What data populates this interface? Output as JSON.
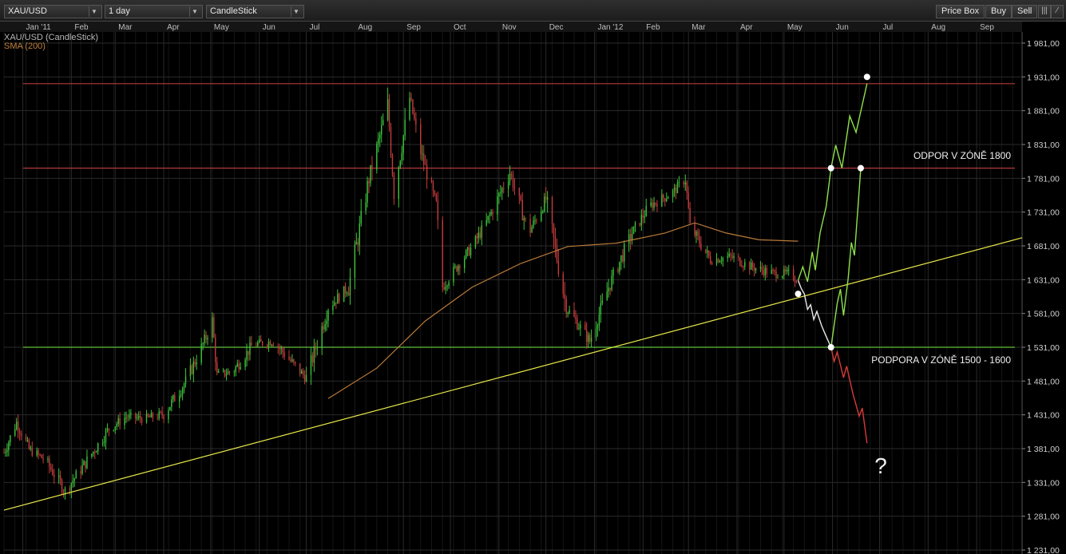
{
  "toolbar": {
    "symbol": "XAU/USD",
    "period": "1 day",
    "chart_type": "CandleStick",
    "price_box_label": "Price Box",
    "buy_label": "Buy",
    "sell_label": "Sell",
    "icons": [
      "bar-chart-icon",
      "draw-line-icon"
    ]
  },
  "legend": {
    "main": "XAU/USD (CandleStick)",
    "indicator": "SMA (200)"
  },
  "colors": {
    "background": "#000000",
    "grid": "#2a2a2a",
    "up_candle": "#3cc43c",
    "down_candle": "#c43c3c",
    "sma": "#b97a3a",
    "resistance": "#b33a3a",
    "support": "#5fbf3a",
    "trendline": "#e8e84a",
    "scenario_bull": "#8fe04a",
    "scenario_bear": "#d83a3a",
    "scenario_neutral": "#e8e8e8"
  },
  "annotations": {
    "resistance_label": "ODPOR V ZÓNĚ 1800",
    "support_label": "PODPORA V ZÓNĚ 1500 - 1600",
    "question_mark": "?"
  },
  "chart_data": {
    "type": "candlestick",
    "title": "",
    "xlabel": "",
    "ylabel": "",
    "ylim": [
      1231,
      1981
    ],
    "grid": true,
    "x_start": "2010-12-20",
    "x_end": "2012-09-30",
    "x_ticks": [
      {
        "label": "Jan '11",
        "date": "2011-01-01"
      },
      {
        "label": "Feb",
        "date": "2011-02-01"
      },
      {
        "label": "Mar",
        "date": "2011-03-01"
      },
      {
        "label": "Apr",
        "date": "2011-04-01"
      },
      {
        "label": "May",
        "date": "2011-05-01"
      },
      {
        "label": "Jun",
        "date": "2011-06-01"
      },
      {
        "label": "Jul",
        "date": "2011-07-01"
      },
      {
        "label": "Aug",
        "date": "2011-08-01"
      },
      {
        "label": "Sep",
        "date": "2011-09-01"
      },
      {
        "label": "Oct",
        "date": "2011-10-01"
      },
      {
        "label": "Nov",
        "date": "2011-11-01"
      },
      {
        "label": "Dec",
        "date": "2011-12-01"
      },
      {
        "label": "Jan '12",
        "date": "2012-01-01"
      },
      {
        "label": "Feb",
        "date": "2012-02-01"
      },
      {
        "label": "Mar",
        "date": "2012-03-01"
      },
      {
        "label": "Apr",
        "date": "2012-04-01"
      },
      {
        "label": "May",
        "date": "2012-05-01"
      },
      {
        "label": "Jun",
        "date": "2012-06-01"
      },
      {
        "label": "Jul",
        "date": "2012-07-01"
      },
      {
        "label": "Aug",
        "date": "2012-08-01"
      },
      {
        "label": "Sep",
        "date": "2012-09-01"
      }
    ],
    "y_ticks": [
      "1 981,00",
      "1 931,00",
      "1 881,00",
      "1 831,00",
      "1 781,00",
      "1 731,00",
      "1 681,00",
      "1 631,00",
      "1 581,00",
      "1 531,00",
      "1 481,00",
      "1 431,00",
      "1 381,00",
      "1 331,00",
      "1 281,00",
      "1 231,00"
    ],
    "y_tick_values": [
      1981,
      1931,
      1881,
      1831,
      1781,
      1731,
      1681,
      1631,
      1581,
      1531,
      1481,
      1431,
      1381,
      1331,
      1281,
      1231
    ],
    "price_path": [
      {
        "date": "2010-12-20",
        "close": 1375
      },
      {
        "date": "2010-12-28",
        "close": 1420
      },
      {
        "date": "2011-01-05",
        "close": 1380
      },
      {
        "date": "2011-01-15",
        "close": 1365
      },
      {
        "date": "2011-01-28",
        "close": 1318
      },
      {
        "date": "2011-02-10",
        "close": 1360
      },
      {
        "date": "2011-02-25",
        "close": 1410
      },
      {
        "date": "2011-03-08",
        "close": 1428
      },
      {
        "date": "2011-03-20",
        "close": 1425
      },
      {
        "date": "2011-04-01",
        "close": 1432
      },
      {
        "date": "2011-04-15",
        "close": 1480
      },
      {
        "date": "2011-04-28",
        "close": 1545
      },
      {
        "date": "2011-05-02",
        "close": 1570
      },
      {
        "date": "2011-05-05",
        "close": 1490
      },
      {
        "date": "2011-05-15",
        "close": 1495
      },
      {
        "date": "2011-05-28",
        "close": 1535
      },
      {
        "date": "2011-06-10",
        "close": 1540
      },
      {
        "date": "2011-06-25",
        "close": 1500
      },
      {
        "date": "2011-07-01",
        "close": 1485
      },
      {
        "date": "2011-07-15",
        "close": 1590
      },
      {
        "date": "2011-07-28",
        "close": 1620
      },
      {
        "date": "2011-08-10",
        "close": 1780
      },
      {
        "date": "2011-08-22",
        "close": 1890
      },
      {
        "date": "2011-08-26",
        "close": 1760
      },
      {
        "date": "2011-09-05",
        "close": 1900
      },
      {
        "date": "2011-09-12",
        "close": 1820
      },
      {
        "date": "2011-09-22",
        "close": 1740
      },
      {
        "date": "2011-09-26",
        "close": 1620
      },
      {
        "date": "2011-10-05",
        "close": 1650
      },
      {
        "date": "2011-10-15",
        "close": 1680
      },
      {
        "date": "2011-10-25",
        "close": 1720
      },
      {
        "date": "2011-11-08",
        "close": 1790
      },
      {
        "date": "2011-11-20",
        "close": 1700
      },
      {
        "date": "2011-12-01",
        "close": 1750
      },
      {
        "date": "2011-12-14",
        "close": 1590
      },
      {
        "date": "2011-12-29",
        "close": 1540
      },
      {
        "date": "2012-01-10",
        "close": 1620
      },
      {
        "date": "2012-01-25",
        "close": 1700
      },
      {
        "date": "2012-02-05",
        "close": 1740
      },
      {
        "date": "2012-02-20",
        "close": 1760
      },
      {
        "date": "2012-02-28",
        "close": 1780
      },
      {
        "date": "2012-03-02",
        "close": 1710
      },
      {
        "date": "2012-03-15",
        "close": 1660
      },
      {
        "date": "2012-03-28",
        "close": 1665
      },
      {
        "date": "2012-04-10",
        "close": 1650
      },
      {
        "date": "2012-04-25",
        "close": 1640
      },
      {
        "date": "2012-05-04",
        "close": 1640
      },
      {
        "date": "2012-05-10",
        "close": 1630
      }
    ],
    "sma_200": [
      {
        "date": "2011-07-15",
        "value": 1455
      },
      {
        "date": "2011-08-15",
        "value": 1500
      },
      {
        "date": "2011-09-15",
        "value": 1570
      },
      {
        "date": "2011-10-15",
        "value": 1620
      },
      {
        "date": "2011-11-15",
        "value": 1655
      },
      {
        "date": "2011-12-15",
        "value": 1680
      },
      {
        "date": "2012-01-15",
        "value": 1685
      },
      {
        "date": "2012-02-15",
        "value": 1700
      },
      {
        "date": "2012-03-05",
        "value": 1715
      },
      {
        "date": "2012-03-25",
        "value": 1700
      },
      {
        "date": "2012-04-15",
        "value": 1690
      },
      {
        "date": "2012-05-10",
        "value": 1688
      }
    ],
    "horizontal_lines": [
      {
        "name": "top resistance",
        "value": 1921,
        "color": "#b33a3a"
      },
      {
        "name": "resistance",
        "value": 1796,
        "color": "#b33a3a"
      },
      {
        "name": "support",
        "value": 1531,
        "color": "#5fbf3a"
      }
    ],
    "trendline": {
      "from": {
        "date": "2010-12-20",
        "value": 1290
      },
      "to": {
        "date": "2012-09-30",
        "value": 1693
      }
    },
    "scenarios": {
      "neutral": [
        {
          "date": "2012-05-10",
          "value": 1630
        },
        {
          "date": "2012-05-12",
          "value": 1618
        },
        {
          "date": "2012-05-14",
          "value": 1610
        },
        {
          "date": "2012-05-16",
          "value": 1587
        },
        {
          "date": "2012-05-18",
          "value": 1594
        },
        {
          "date": "2012-05-20",
          "value": 1572
        },
        {
          "date": "2012-05-22",
          "value": 1584
        },
        {
          "date": "2012-05-25",
          "value": 1563
        },
        {
          "date": "2012-05-27",
          "value": 1552
        },
        {
          "date": "2012-05-31",
          "value": 1531
        }
      ],
      "bull_1": [
        {
          "date": "2012-05-10",
          "value": 1630
        },
        {
          "date": "2012-05-13",
          "value": 1650
        },
        {
          "date": "2012-05-16",
          "value": 1628
        },
        {
          "date": "2012-05-19",
          "value": 1672
        },
        {
          "date": "2012-05-21",
          "value": 1645
        },
        {
          "date": "2012-05-24",
          "value": 1700
        },
        {
          "date": "2012-05-28",
          "value": 1740
        },
        {
          "date": "2012-05-31",
          "value": 1796
        },
        {
          "date": "2012-06-03",
          "value": 1830
        },
        {
          "date": "2012-06-07",
          "value": 1796
        },
        {
          "date": "2012-06-12",
          "value": 1873
        },
        {
          "date": "2012-06-16",
          "value": 1849
        },
        {
          "date": "2012-06-23",
          "value": 1921
        }
      ],
      "bull_2": [
        {
          "date": "2012-05-31",
          "value": 1531
        },
        {
          "date": "2012-06-04",
          "value": 1596
        },
        {
          "date": "2012-06-06",
          "value": 1617
        },
        {
          "date": "2012-06-08",
          "value": 1578
        },
        {
          "date": "2012-06-11",
          "value": 1634
        },
        {
          "date": "2012-06-13",
          "value": 1686
        },
        {
          "date": "2012-06-15",
          "value": 1667
        },
        {
          "date": "2012-06-19",
          "value": 1796
        }
      ],
      "bear": [
        {
          "date": "2012-05-31",
          "value": 1531
        },
        {
          "date": "2012-06-02",
          "value": 1510
        },
        {
          "date": "2012-06-04",
          "value": 1524
        },
        {
          "date": "2012-06-08",
          "value": 1486
        },
        {
          "date": "2012-06-10",
          "value": 1503
        },
        {
          "date": "2012-06-14",
          "value": 1462
        },
        {
          "date": "2012-06-18",
          "value": 1429
        },
        {
          "date": "2012-06-20",
          "value": 1441
        },
        {
          "date": "2012-06-23",
          "value": 1389
        }
      ]
    },
    "key_points": [
      {
        "date": "2012-05-10",
        "value": 1610
      },
      {
        "date": "2012-05-31",
        "value": 1531
      },
      {
        "date": "2012-05-31",
        "value": 1796
      },
      {
        "date": "2012-06-19",
        "value": 1796
      },
      {
        "date": "2012-06-23",
        "value": 1931
      }
    ]
  }
}
